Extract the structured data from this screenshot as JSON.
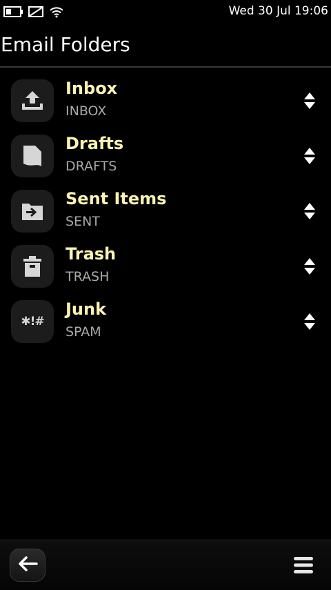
{
  "status_bar": {
    "clock": "Wed 30 Jul 19:06",
    "icons": [
      "battery-icon",
      "no-sim-icon",
      "wifi-icon"
    ]
  },
  "page": {
    "title": "Email Folders"
  },
  "folders": [
    {
      "name": "Inbox",
      "subtitle": "INBOX",
      "icon": "inbox-upload-icon"
    },
    {
      "name": "Drafts",
      "subtitle": "DRAFTS",
      "icon": "drafts-document-icon"
    },
    {
      "name": "Sent Items",
      "subtitle": "SENT",
      "icon": "sent-folder-icon"
    },
    {
      "name": "Trash",
      "subtitle": "TRASH",
      "icon": "trash-icon"
    },
    {
      "name": "Junk",
      "subtitle": "SPAM",
      "icon": "junk-icon",
      "icon_glyph": "✱!#"
    }
  ],
  "toolbar": {
    "back_icon": "back-arrow-icon",
    "menu_icon": "menu-icon"
  },
  "colors": {
    "background": "#000000",
    "folder_name": "#fbf3b2",
    "folder_subtitle": "#a9a9a9",
    "icon_tile": "#1c1c1c",
    "icon_glyph": "#d6d6d6",
    "divider": "#3a3a3a"
  }
}
